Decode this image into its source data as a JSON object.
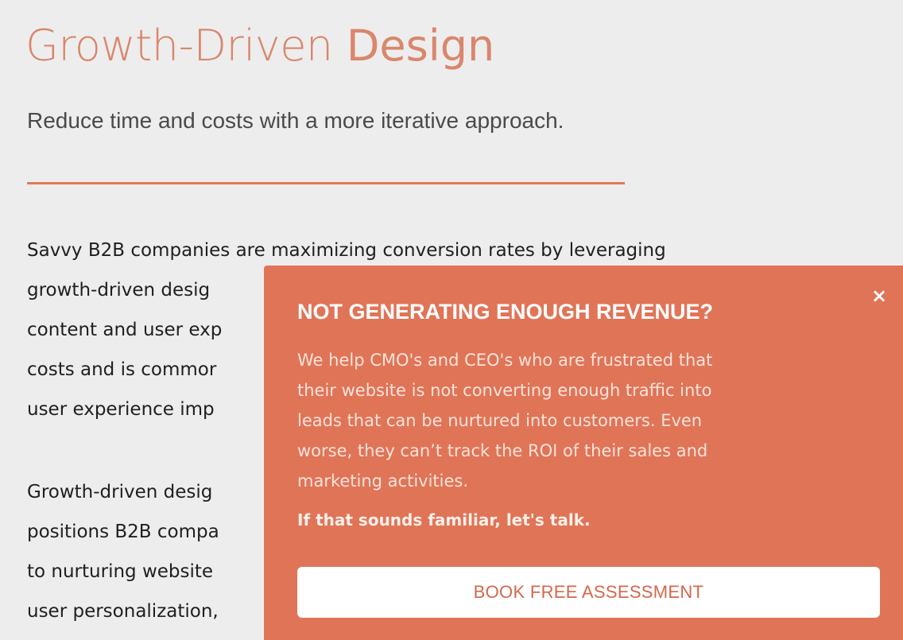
{
  "page": {
    "title_part1": "Growth-Driven",
    "title_part2": "Design",
    "subtitle": "Reduce time and costs with a more iterative approach.",
    "paragraph1_lines": [
      "Savvy B2B companies are maximizing conversion rates by leveraging",
      "growth-driven desig",
      "content and user exp",
      "costs and is commor",
      "user experience imp"
    ],
    "paragraph2_lines": [
      "Growth-driven desig",
      "positions B2B compa",
      "to nurturing website",
      "user personalization,"
    ]
  },
  "popup": {
    "close_label": "×",
    "heading": "NOT GENERATING ENOUGH REVENUE?",
    "body_lines": [
      "We help CMO's and CEO's who are frustrated that",
      "their website is not converting enough traffic into",
      "leads that can be nurtured into customers. Even",
      "worse, they can’t track the ROI of their sales and",
      "marketing activities."
    ],
    "cta_text": "If that sounds familiar, let's talk.",
    "button_label": "BOOK FREE ASSESSMENT"
  },
  "colors": {
    "accent": "#e07a5d",
    "popup_background": "#e07457",
    "page_background": "#ededee"
  }
}
